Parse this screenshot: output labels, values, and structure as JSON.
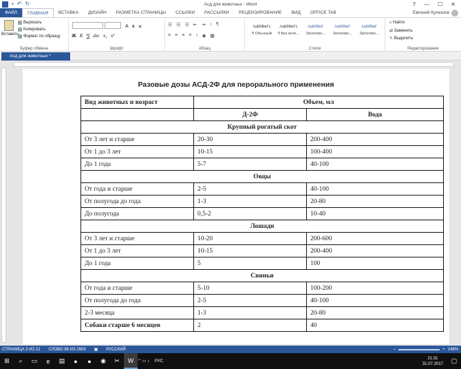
{
  "window": {
    "title": "Асд для животных - Word",
    "min": "—",
    "max": "☐",
    "close": "✕",
    "help": "?"
  },
  "ribbon_tabs": [
    {
      "label": "ФАЙЛ"
    },
    {
      "label": "ГЛАВНАЯ"
    },
    {
      "label": "ВСТАВКА"
    },
    {
      "label": "ДИЗАЙН"
    },
    {
      "label": "РАЗМЕТКА СТРАНИЦЫ"
    },
    {
      "label": "ССЫЛКИ"
    },
    {
      "label": "РАССЫЛКИ"
    },
    {
      "label": "РЕЦЕНЗИРОВАНИЕ"
    },
    {
      "label": "ВИД"
    },
    {
      "label": "OFFICE TAB"
    }
  ],
  "user": "Евгений Кулешов",
  "clipboard": {
    "paste": "Вставить",
    "cut": "Вырезать",
    "copy": "Копировать",
    "format": "Формат по образцу",
    "label": "Буфер обмена"
  },
  "font": {
    "name": "",
    "size": "",
    "label": "Шрифт"
  },
  "paragraph": {
    "label": "Абзац"
  },
  "styles": {
    "label": "Стили",
    "items": [
      {
        "sample": "АаБбВвГг,",
        "name": "¶ Обычный"
      },
      {
        "sample": "АаБбВвГг,",
        "name": "¶ Без инте..."
      },
      {
        "sample": "АаБбВвГ",
        "name": "Заголово..."
      },
      {
        "sample": "АаБбВвГ",
        "name": "Заголово..."
      },
      {
        "sample": "АаБбВвГ",
        "name": "Заголово..."
      }
    ]
  },
  "editing": {
    "find": "Найти",
    "replace": "Заменить",
    "select": "Выделить",
    "label": "Редактирование"
  },
  "doc_tab": "Асд для животных *",
  "document": {
    "title": "Разовые дозы АСД-2Ф для перорального применения",
    "header": {
      "col1": "Вид животных и возраст",
      "volume": "Объем, мл",
      "d2f": "Д-2Ф",
      "water": "Вода"
    },
    "sections": [
      {
        "name": "Крупный рогатый скот",
        "rows": [
          [
            "От 3 лет и старше",
            "20-30",
            "200-400"
          ],
          [
            "От 1 до 3 лет",
            "10-15",
            "100-400"
          ],
          [
            "До 1 года",
            "5-7",
            "40-100"
          ]
        ]
      },
      {
        "name": "Овцы",
        "rows": [
          [
            "От года и старше",
            "2-5",
            "40-100"
          ],
          [
            "От полугода до года",
            "1-3",
            "20-80"
          ],
          [
            "До полугода",
            "0,5-2",
            "10-40"
          ]
        ]
      },
      {
        "name": "Лошади",
        "rows": [
          [
            "От 3 лет и старше",
            "10-20",
            "200-600"
          ],
          [
            "От 1 до 3 лет",
            "10-15",
            "200-400"
          ],
          [
            "До 1 года",
            "5",
            "100"
          ]
        ]
      },
      {
        "name": "Свиньи",
        "rows": [
          [
            "От года и старше",
            "5-10",
            "100-200"
          ],
          [
            "От полугода до года",
            "2-5",
            "40-100"
          ],
          [
            "2-3 месяца",
            "1-3",
            "20-80"
          ]
        ]
      }
    ],
    "last_row": [
      "Собаки старше 6 месяцев",
      "2",
      "40"
    ]
  },
  "status": {
    "page": "СТРАНИЦА 3 ИЗ 12",
    "words": "СЛОВО 96 ИЗ 2603",
    "lang": "РУССКИЙ",
    "zoom": "148%"
  },
  "taskbar": {
    "lang": "РУС",
    "time": "21:31",
    "date": "31.07.2017"
  }
}
